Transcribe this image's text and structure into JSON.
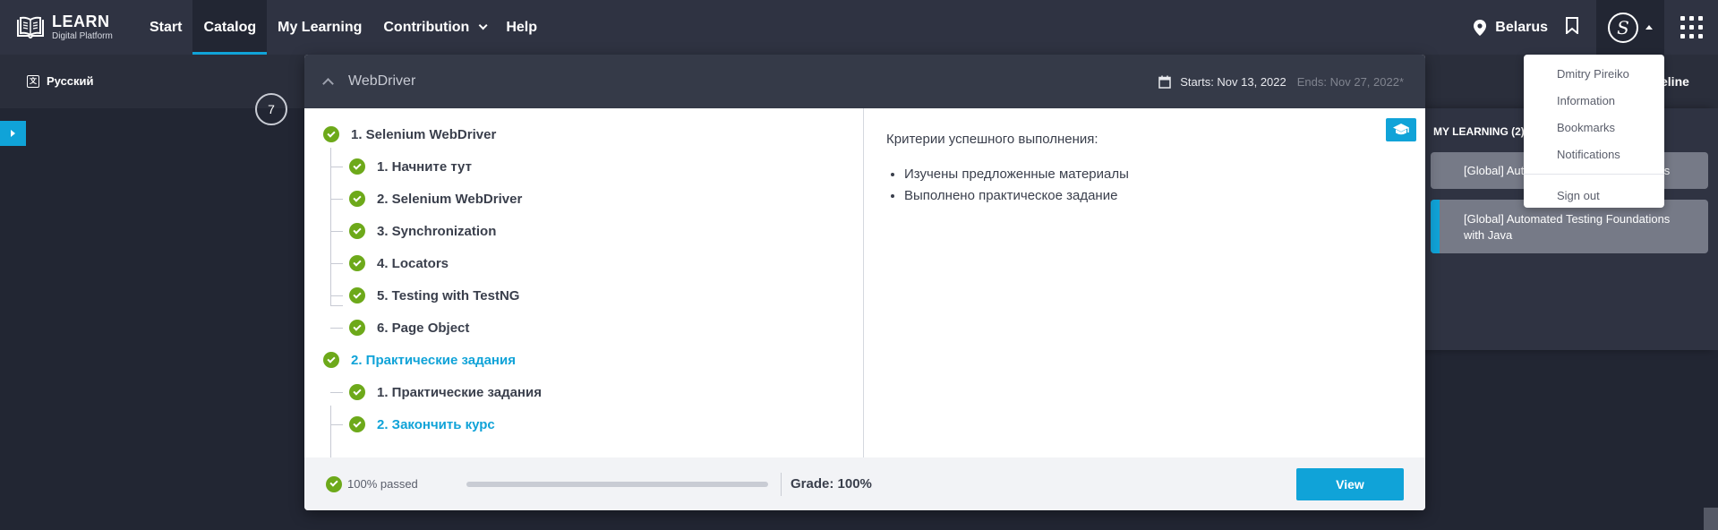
{
  "app": {
    "logo_main": "LEARN",
    "logo_sub": "Digital Platform"
  },
  "nav": [
    {
      "label": "Start",
      "active": false
    },
    {
      "label": "Catalog",
      "active": true
    },
    {
      "label": "My Learning",
      "active": false
    },
    {
      "label": "Contribution",
      "active": false,
      "has_dropdown": true
    },
    {
      "label": "Help",
      "active": false
    }
  ],
  "header": {
    "location": "Belarus",
    "avatar_letter": "S"
  },
  "user_menu": {
    "items": [
      "Dmitry Pireiko",
      "Information",
      "Bookmarks",
      "Notifications"
    ],
    "sign_out": "Sign out"
  },
  "subbar": {
    "language": "Русский",
    "timeline_fragment": "eline"
  },
  "counter": "7",
  "course": {
    "title": "WebDriver",
    "starts": "Starts: Nov 13, 2022",
    "ends": "Ends: Nov 27, 2022*",
    "tree": [
      {
        "label": "1. Selenium WebDriver",
        "level": 0,
        "current": false
      },
      {
        "label": "1. Начните тут",
        "level": 1,
        "current": false
      },
      {
        "label": "2. Selenium WebDriver",
        "level": 1,
        "current": false
      },
      {
        "label": "3. Synchronization",
        "level": 1,
        "current": false
      },
      {
        "label": "4. Locators",
        "level": 1,
        "current": false
      },
      {
        "label": "5. Testing with TestNG",
        "level": 1,
        "current": false
      },
      {
        "label": "6. Page Object",
        "level": 1,
        "current": false
      },
      {
        "label": "2. Практические задания",
        "level": 0,
        "current": true
      },
      {
        "label": "1. Практические задания",
        "level": 1,
        "current": false
      },
      {
        "label": "2. Закончить курс",
        "level": 1,
        "current": true
      }
    ],
    "description": {
      "title": "Критерии успешного выполнения:",
      "items": [
        "Изучены предложенные материалы",
        "Выполнено практическое задание"
      ]
    },
    "footer": {
      "passed": "100% passed",
      "progress": 0,
      "grade": "Grade: 100%",
      "view_label": "View"
    }
  },
  "my_learning": {
    "header": "MY LEARNING (2)",
    "cards": [
      {
        "title": "[Global] Automated Testing Foundations",
        "selected": false
      },
      {
        "title": "[Global] Automated Testing Foundations with Java",
        "selected": true
      }
    ]
  },
  "colors": {
    "accent": "#10a3d8",
    "check": "#6da91a",
    "topbar": "#2f3342",
    "background": "#222633"
  }
}
